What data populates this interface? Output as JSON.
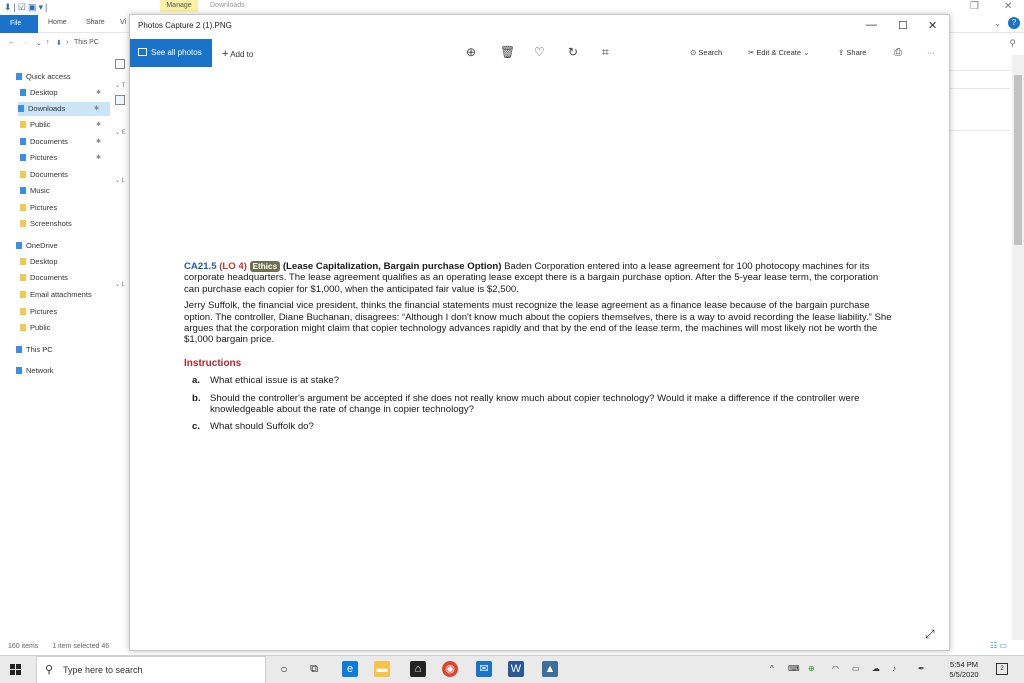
{
  "explorer": {
    "manage_tab": "Manage",
    "window_title": "Downloads",
    "ribbon": {
      "file": "File",
      "home": "Home",
      "share": "Share",
      "view": "Vi"
    },
    "address": {
      "path": "This PC"
    },
    "nav": [
      {
        "label": "Quick access",
        "icon": "star-icon"
      },
      {
        "label": "Desktop",
        "icon": "desktop-icon",
        "pinned": true
      },
      {
        "label": "Downloads",
        "icon": "download-icon",
        "pinned": true,
        "selected": true
      },
      {
        "label": "Public",
        "icon": "folder-icon",
        "pinned": true
      },
      {
        "label": "Documents",
        "icon": "documents-icon",
        "pinned": true
      },
      {
        "label": "Pictures",
        "icon": "pictures-icon",
        "pinned": true
      },
      {
        "label": "Documents",
        "icon": "folder-icon"
      },
      {
        "label": "Music",
        "icon": "music-icon"
      },
      {
        "label": "Pictures",
        "icon": "folder-icon"
      },
      {
        "label": "Screenshots",
        "icon": "folder-icon"
      },
      {
        "label": "OneDrive",
        "icon": "cloud-icon"
      },
      {
        "label": "Desktop",
        "icon": "folder-icon"
      },
      {
        "label": "Documents",
        "icon": "folder-icon"
      },
      {
        "label": "Email attachments",
        "icon": "folder-icon"
      },
      {
        "label": "Pictures",
        "icon": "folder-icon"
      },
      {
        "label": "Public",
        "icon": "folder-icon"
      },
      {
        "label": "This PC",
        "icon": "computer-icon"
      },
      {
        "label": "Network",
        "icon": "network-icon"
      }
    ],
    "status": {
      "items": "160 items",
      "selected": "1 item selected  46"
    },
    "column_chevron_labels": [
      "T",
      "E",
      "L",
      "L"
    ]
  },
  "photos": {
    "title": "Photos  Capture 2 (1).PNG",
    "toolbar": {
      "see_all": "See all photos",
      "add_to": "Add to",
      "search": "Search",
      "edit_create": "Edit & Create",
      "share": "Share",
      "more": "···"
    },
    "document": {
      "code": "CA21.5",
      "lo": "(LO 4)",
      "tag": "Ethics",
      "heading": "(Lease Capitalization, Bargain purchase Option)",
      "para1": "Baden Corporation entered into a lease agreement for 100 photocopy machines for its corporate headquarters. The lease agreement qualifies as an operating lease except there is a bargain purchase option. After the 5-year lease term, the corporation can purchase each copier for $1,000, when the anticipated fair value is $2,500.",
      "para2": "Jerry Suffolk, the financial vice president, thinks the financial statements must recognize the lease agreement as a finance lease because of the bargain purchase option. The controller, Diane Buchanan, disagrees: “Although I don't know much about the copiers themselves, there is a way to avoid recording the lease liability.” She argues that the corporation might claim that copier technology advances rapidly and that by the end of the lease term, the machines will most likely not be worth the $1,000 bargain price.",
      "instructions_label": "Instructions",
      "questions": [
        {
          "letter": "a.",
          "text": "What ethical issue is at stake?"
        },
        {
          "letter": "b.",
          "text": "Should the controller's argument be accepted if she does not really know much about copier technology? Would it make a difference if the controller were knowledgeable about the rate of change in copier technology?"
        },
        {
          "letter": "c.",
          "text": "What should Suffolk do?"
        }
      ]
    }
  },
  "taskbar": {
    "search_placeholder": "Type here to search",
    "time": "5:54 PM",
    "date": "5/5/2020",
    "notification_count": "2"
  },
  "colors": {
    "accent": "#1a73c8",
    "lo_red": "#c0392b",
    "instructions_red": "#b0262f",
    "ethics_tag": "#6f6f51",
    "selection": "#cce4f7"
  }
}
